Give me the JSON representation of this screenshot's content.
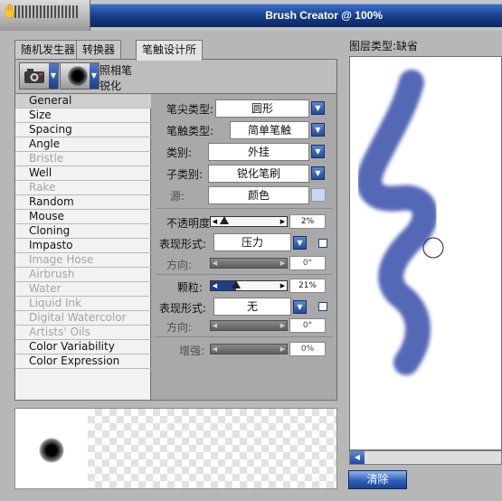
{
  "window": {
    "title": "Brush Creator @ 100%"
  },
  "tabs": [
    {
      "label": "随机发生器"
    },
    {
      "label": "转换器"
    },
    {
      "label": "笔触设计所"
    }
  ],
  "preset": {
    "category": "照相笔",
    "variant": "锐化"
  },
  "categories": [
    {
      "label": "General",
      "enabled": true,
      "selected": true
    },
    {
      "label": "Size",
      "enabled": true
    },
    {
      "label": "Spacing",
      "enabled": true
    },
    {
      "label": "Angle",
      "enabled": true
    },
    {
      "label": "Bristle",
      "enabled": false
    },
    {
      "label": "Well",
      "enabled": true
    },
    {
      "label": "Rake",
      "enabled": false
    },
    {
      "label": "Random",
      "enabled": true
    },
    {
      "label": "Mouse",
      "enabled": true
    },
    {
      "label": "Cloning",
      "enabled": true
    },
    {
      "label": "Impasto",
      "enabled": true
    },
    {
      "label": "Image Hose",
      "enabled": false
    },
    {
      "label": "Airbrush",
      "enabled": false
    },
    {
      "label": "Water",
      "enabled": false
    },
    {
      "label": "Liquid Ink",
      "enabled": false
    },
    {
      "label": "Digital Watercolor",
      "enabled": false
    },
    {
      "label": "Artists' Oils",
      "enabled": false
    },
    {
      "label": "Color Variability",
      "enabled": true
    },
    {
      "label": "Color Expression",
      "enabled": true
    }
  ],
  "general": {
    "dab_type": {
      "label": "笔尖类型:",
      "value": "圆形"
    },
    "stroke_type": {
      "label": "笔触类型:",
      "value": "简单笔触"
    },
    "method": {
      "label": "类别:",
      "value": "外挂"
    },
    "subcategory": {
      "label": "子类别:",
      "value": "锐化笔刷"
    },
    "source": {
      "label": "源:",
      "value": "颜色"
    },
    "opacity": {
      "label": "不透明度:",
      "value": "2%",
      "level": 0.02
    },
    "opacity_expression": {
      "label": "表现形式:",
      "value": "压力",
      "direction_label": "方向:",
      "direction_value": "0°"
    },
    "grain": {
      "label": "颗粒:",
      "value": "21%",
      "level": 0.21
    },
    "grain_expression": {
      "label": "表现形式:",
      "value": "无",
      "direction_label": "方向:",
      "direction_value": "0°"
    },
    "boost": {
      "label": "增强:",
      "value": "0%"
    }
  },
  "canvas": {
    "layer_type_label": "图层类型:",
    "layer_type_value": "缺省",
    "stroke_color": "#5467b6"
  },
  "buttons": {
    "clear": "清除"
  }
}
